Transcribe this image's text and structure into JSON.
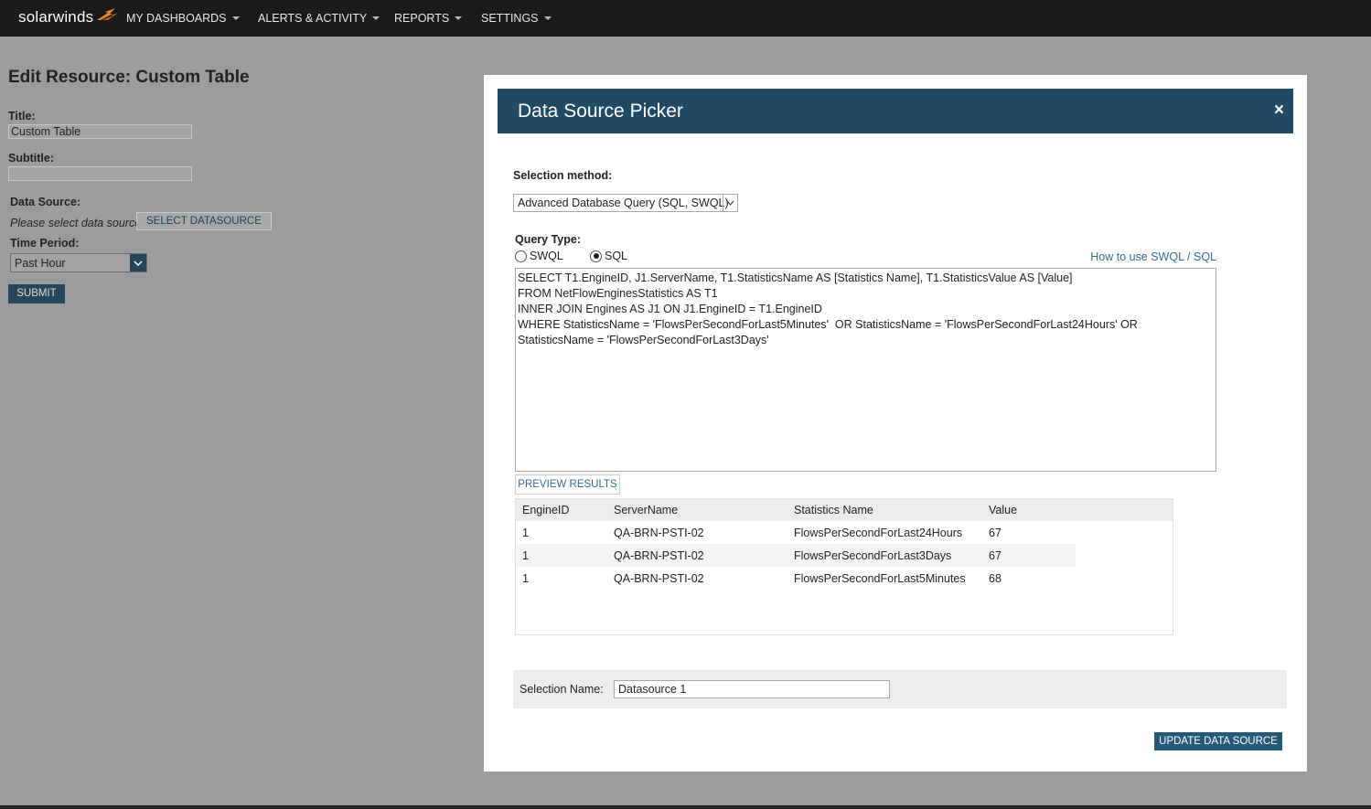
{
  "nav": {
    "logo": "solarwinds",
    "items": [
      {
        "label": "MY DASHBOARDS"
      },
      {
        "label": "ALERTS & ACTIVITY"
      },
      {
        "label": "REPORTS"
      },
      {
        "label": "SETTINGS"
      }
    ]
  },
  "edit": {
    "heading": "Edit Resource: Custom Table",
    "title_label": "Title:",
    "title_value": "Custom Table",
    "subtitle_label": "Subtitle:",
    "subtitle_value": "",
    "datasource_label": "Data Source:",
    "datasource_placeholder": "Please select data source",
    "select_datasource_button": "SELECT DATASOURCE",
    "time_period_label": "Time Period:",
    "time_period_value": "Past Hour",
    "submit_button": "SUBMIT"
  },
  "modal": {
    "title": "Data Source Picker",
    "close_glyph": "×",
    "selection_method_label": "Selection method:",
    "selection_method_value": "Advanced Database Query (SQL, SWQL)",
    "query_type_label": "Query Type:",
    "query_types": [
      {
        "label": "SWQL",
        "selected": false
      },
      {
        "label": "SQL",
        "selected": true
      }
    ],
    "help_link": "How to use SWQL / SQL",
    "query_text": "SELECT T1.EngineID, J1.ServerName, T1.StatisticsName AS [Statistics Name], T1.StatisticsValue AS [Value]\nFROM NetFlowEnginesStatistics AS T1\nINNER JOIN Engines AS J1 ON J1.EngineID = T1.EngineID\nWHERE StatisticsName = 'FlowsPerSecondForLast5Minutes'  OR StatisticsName = 'FlowsPerSecondForLast24Hours' OR StatisticsName = 'FlowsPerSecondForLast3Days'",
    "preview_button": "PREVIEW RESULTS",
    "results": {
      "columns": [
        "EngineID",
        "ServerName",
        "Statistics Name",
        "Value"
      ],
      "rows": [
        [
          "1",
          "QA-BRN-PSTI-02",
          "FlowsPerSecondForLast24Hours",
          "67"
        ],
        [
          "1",
          "QA-BRN-PSTI-02",
          "FlowsPerSecondForLast3Days",
          "67"
        ],
        [
          "1",
          "QA-BRN-PSTI-02",
          "FlowsPerSecondForLast5Minutes",
          "68"
        ]
      ]
    },
    "selection_name_label": "Selection Name:",
    "selection_name_value": "Datasource 1",
    "update_button": "UPDATE DATA SOURCE"
  },
  "colors": {
    "header_bg": "#204a66",
    "accent": "#25597a",
    "link": "#2f6d93",
    "topbar": "#1a1a1a",
    "logo_flame": "#f08a24"
  }
}
